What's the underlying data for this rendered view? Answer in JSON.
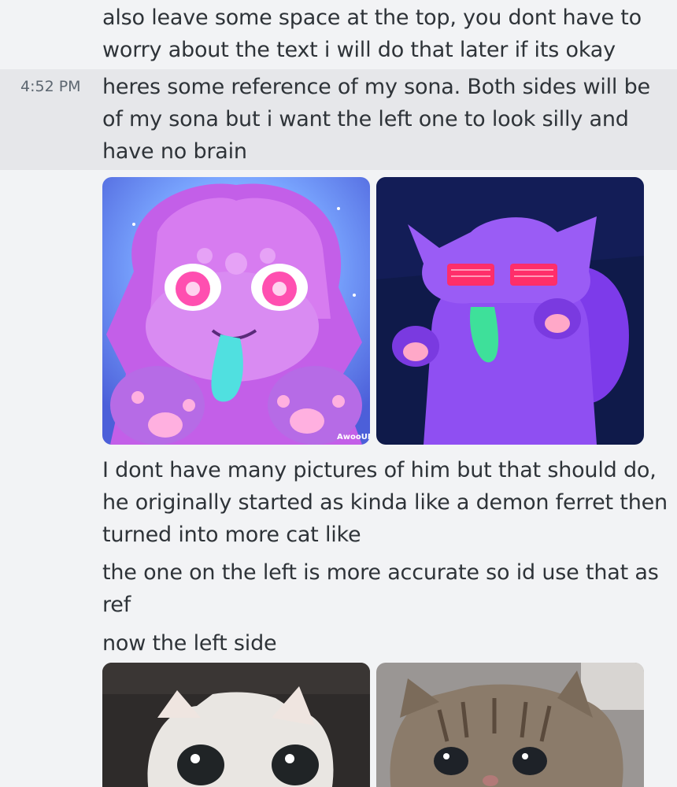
{
  "messages": {
    "m0_line1": "also leave some space at the top, you dont have to",
    "m0_line2": "worry about the text  i will do that later if its okay",
    "m1_timestamp": "4:52 PM",
    "m1_line1": "heres some reference of my sona. Both sides will be",
    "m1_line2": "of my sona but i want the left one to look silly and",
    "m1_line3": "have no brain",
    "m2_line1": "I dont have many pictures of him but that should do,",
    "m2_line2": "he originally started as kinda like a demon ferret then",
    "m2_line3": "turned into more cat like",
    "m3_line1": "the one on the left is more accurate so id use that as",
    "m3_line2": "ref",
    "m4_line1": "now the left side"
  },
  "attachments": {
    "art_left": {
      "name": "purple-creature-art-1",
      "signature": "AwooUF"
    },
    "art_right": {
      "name": "purple-creature-art-2"
    },
    "photo_left": {
      "name": "white-kitten-photo"
    },
    "photo_right": {
      "name": "tabby-kitten-photo"
    }
  },
  "colors": {
    "background": "#f2f3f5",
    "highlight": "#e6e7ea",
    "text": "#2e3338",
    "timestamp": "#5c6670"
  }
}
